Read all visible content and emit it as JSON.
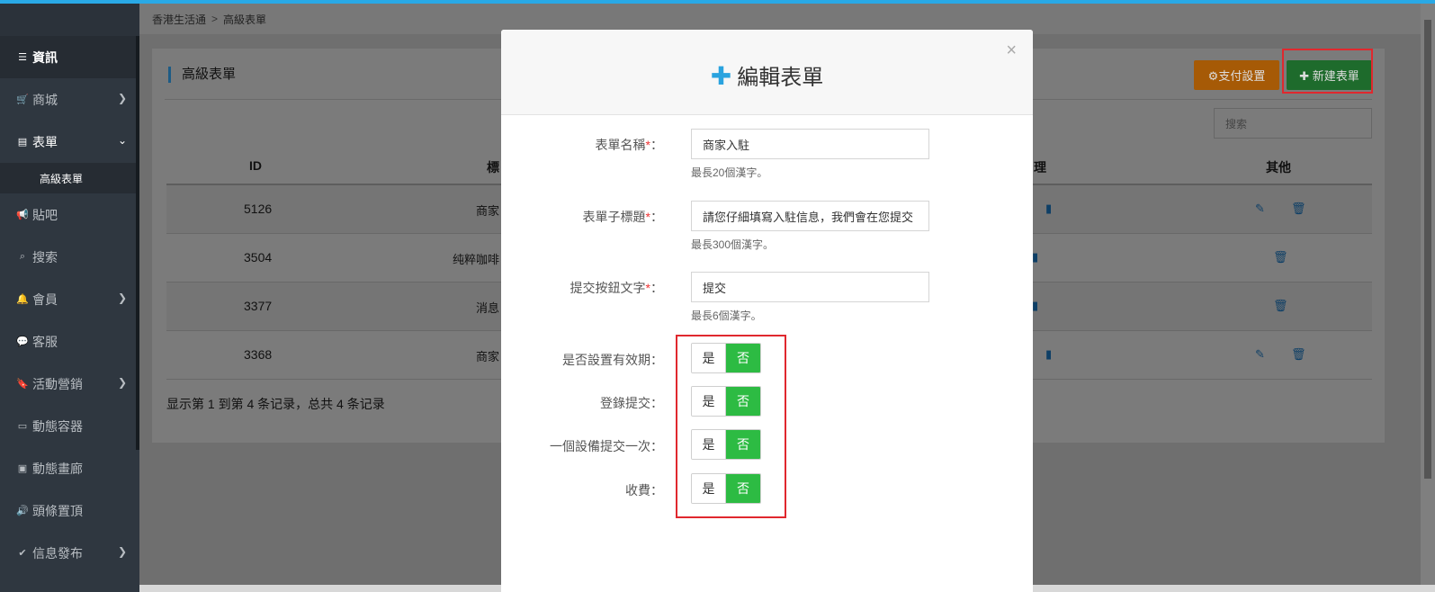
{
  "sidebar": {
    "items": [
      {
        "icon": "list-icon",
        "label": "資訊",
        "active": true
      },
      {
        "icon": "cart-icon",
        "label": "商城",
        "chevron": ">"
      },
      {
        "icon": "form-icon",
        "label": "表單",
        "chevron": "v",
        "open": true
      },
      {
        "icon": "bullhorn-icon",
        "label": "貼吧"
      },
      {
        "icon": "search-icon",
        "label": "搜索"
      },
      {
        "icon": "bell-icon",
        "label": "會員",
        "chevron": ">"
      },
      {
        "icon": "comment-icon",
        "label": "客服"
      },
      {
        "icon": "bookmark-icon",
        "label": "活動營銷",
        "chevron": ">"
      },
      {
        "icon": "hdd-icon",
        "label": "動態容器"
      },
      {
        "icon": "picture-icon",
        "label": "動態畫廊"
      },
      {
        "icon": "volume-icon",
        "label": "頭條置頂"
      },
      {
        "icon": "check-icon",
        "label": "信息發布",
        "chevron": ">"
      }
    ],
    "sub_item": "高級表單"
  },
  "breadcrumb": {
    "root": "香港生活通",
    "sep": ">",
    "current": "高級表單"
  },
  "panel": {
    "title": "高級表單",
    "pay_button": "⚙支付設置",
    "new_button": "✚ 新建表單",
    "search_placeholder": "搜索",
    "headers": {
      "id": "ID",
      "title": "標",
      "manage": "理",
      "other": "其他"
    },
    "rows": [
      {
        "id": "5126",
        "title": "商家"
      },
      {
        "id": "3504",
        "title": "纯粹咖啡"
      },
      {
        "id": "3377",
        "title": "消息"
      },
      {
        "id": "3368",
        "title": "商家"
      }
    ],
    "footer": "显示第 1 到第 4 条记录，总共 4 条记录"
  },
  "modal": {
    "title": "編輯表單",
    "close": "×",
    "fields": [
      {
        "label": "表單名稱",
        "value": "商家入駐",
        "help": "最長20個漢字。"
      },
      {
        "label": "表單子標題",
        "value": "請您仔細填寫入駐信息，我們會在您提交",
        "help": "最長300個漢字。"
      },
      {
        "label": "提交按鈕文字",
        "value": "提交",
        "help": "最長6個漢字。"
      }
    ],
    "required_mark": "*",
    "colon": "：",
    "toggles": [
      {
        "label": "是否設置有效期：",
        "yes": "是",
        "no": "否"
      },
      {
        "label": "登錄提交：",
        "yes": "是",
        "no": "否"
      },
      {
        "label": "一個設備提交一次：",
        "yes": "是",
        "no": "否"
      },
      {
        "label": "收費：",
        "yes": "是",
        "no": "否"
      }
    ]
  },
  "colors": {
    "accent": "#29a9e6",
    "toggle_on": "#2dbb43",
    "highlight": "#e0282e"
  }
}
